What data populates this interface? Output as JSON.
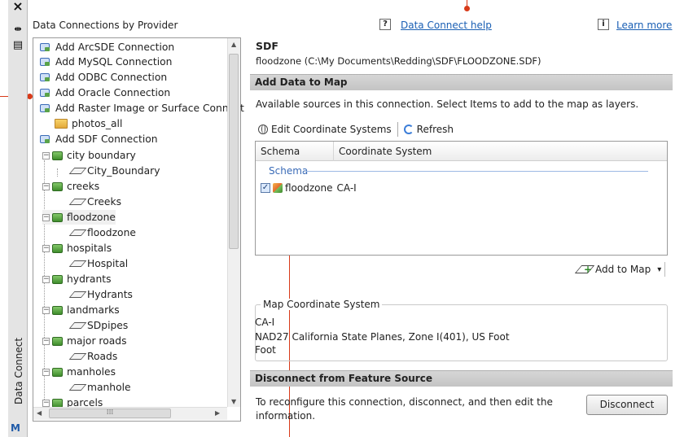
{
  "palette": {
    "close_glyph": "×",
    "pin_glyph": "⇹",
    "props_glyph": "▤",
    "title": "Data Connect",
    "logo": "M"
  },
  "tree": {
    "title": "Data Connections by Provider",
    "items": [
      {
        "label": "Add ArcSDE Connection",
        "icon": "connection-icon"
      },
      {
        "label": "Add MySQL Connection",
        "icon": "connection-icon"
      },
      {
        "label": "Add ODBC Connection",
        "icon": "connection-icon"
      },
      {
        "label": "Add Oracle Connection",
        "icon": "connection-icon"
      },
      {
        "label": "Add Raster Image or Surface Connect",
        "icon": "raster-connection-icon"
      },
      {
        "label": "photos_all",
        "icon": "folder-icon"
      },
      {
        "label": "Add SDF Connection",
        "icon": "connection-icon"
      },
      {
        "label": "city boundary",
        "icon": "feature-class-icon"
      },
      {
        "label": "City_Boundary",
        "icon": "layer-icon"
      },
      {
        "label": "creeks",
        "icon": "feature-class-icon"
      },
      {
        "label": "Creeks",
        "icon": "layer-icon"
      },
      {
        "label": "floodzone",
        "icon": "feature-class-icon"
      },
      {
        "label": "floodzone",
        "icon": "layer-icon"
      },
      {
        "label": "hospitals",
        "icon": "feature-class-icon"
      },
      {
        "label": "Hospital",
        "icon": "layer-icon"
      },
      {
        "label": "hydrants",
        "icon": "feature-class-icon"
      },
      {
        "label": "Hydrants",
        "icon": "layer-icon"
      },
      {
        "label": "landmarks",
        "icon": "feature-class-icon"
      },
      {
        "label": "SDpipes",
        "icon": "layer-icon"
      },
      {
        "label": "major roads",
        "icon": "feature-class-icon"
      },
      {
        "label": "Roads",
        "icon": "layer-icon"
      },
      {
        "label": "manholes",
        "icon": "feature-class-icon"
      },
      {
        "label": "manhole",
        "icon": "layer-icon"
      },
      {
        "label": "parcels",
        "icon": "feature-class-icon"
      }
    ],
    "scroll_glyph": "⁞⁞⁞"
  },
  "header": {
    "help_icon": "?",
    "help_link": "Data Connect help",
    "info_icon": "i",
    "learn_more": "Learn more"
  },
  "detail": {
    "provider": "SDF",
    "source": "floodzone (C:\\My Documents\\Redding\\SDF\\FLOODZONE.SDF)",
    "add_section": "Add Data to Map",
    "available_text": "Available sources in this connection.  Select Items to add to the map as layers.",
    "edit_cs": "Edit Coordinate Systems",
    "refresh": "Refresh",
    "col_schema": "Schema",
    "col_cs": "Coordinate System",
    "group": "Schema",
    "row": {
      "checked": true,
      "check_glyph": "✓",
      "name": "floodzone",
      "cs": "CA-I"
    },
    "add_to_map": "Add to Map",
    "add_to_map_arrow": "▾",
    "mcs_legend": "Map Coordinate System",
    "mcs_code": "CA-I",
    "mcs_desc": "NAD27 California State Planes, Zone I(401), US Foot",
    "mcs_unit": "Foot",
    "disconnect_section": "Disconnect from Feature Source",
    "disconnect_text": "To reconfigure this connection, disconnect, and then edit the information.",
    "disconnect_btn": "Disconnect"
  },
  "colors": {
    "callout": "#d83a19",
    "link": "#1a5fb4"
  }
}
